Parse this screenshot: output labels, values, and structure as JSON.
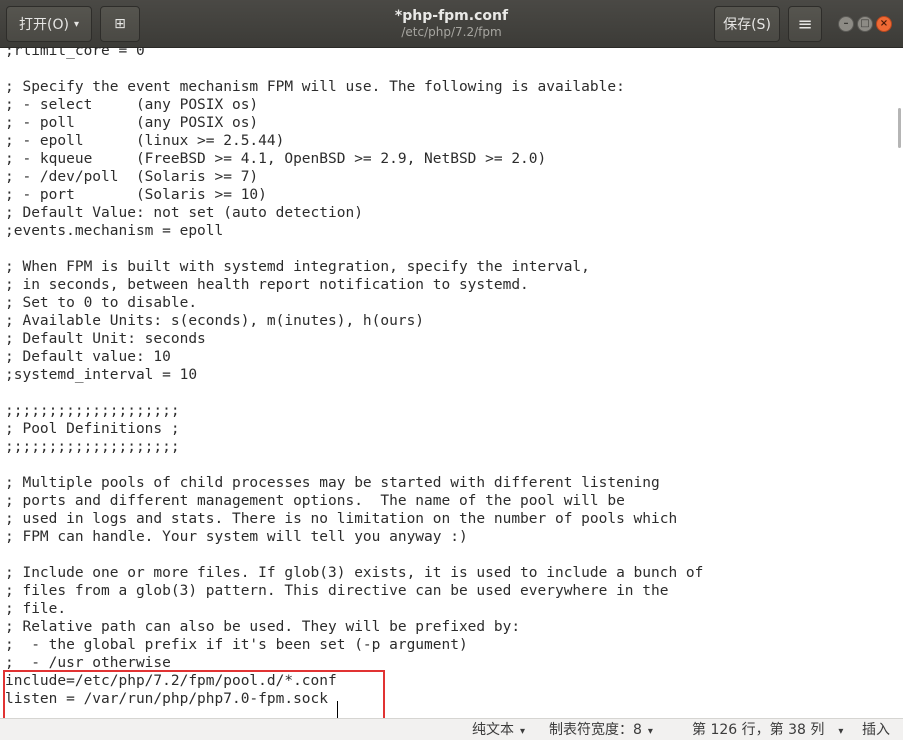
{
  "titlebar": {
    "open_label": "打开(O)",
    "open_caret": "▾",
    "newtab_icon": "⊞",
    "title": "*php-fpm.conf",
    "path": "/etc/php/7.2/fpm",
    "save_label": "保存(S)",
    "menu_icon": "≡",
    "minimize_icon": "–",
    "maximize_icon": "□",
    "close_icon": "×"
  },
  "editor": {
    "lines": [
      ";rlimit_core = 0",
      "",
      "; Specify the event mechanism FPM will use. The following is available:",
      "; - select     (any POSIX os)",
      "; - poll       (any POSIX os)",
      "; - epoll      (linux >= 2.5.44)",
      "; - kqueue     (FreeBSD >= 4.1, OpenBSD >= 2.9, NetBSD >= 2.0)",
      "; - /dev/poll  (Solaris >= 7)",
      "; - port       (Solaris >= 10)",
      "; Default Value: not set (auto detection)",
      ";events.mechanism = epoll",
      "",
      "; When FPM is built with systemd integration, specify the interval,",
      "; in seconds, between health report notification to systemd.",
      "; Set to 0 to disable.",
      "; Available Units: s(econds), m(inutes), h(ours)",
      "; Default Unit: seconds",
      "; Default value: 10",
      ";systemd_interval = 10",
      "",
      ";;;;;;;;;;;;;;;;;;;;",
      "; Pool Definitions ;",
      ";;;;;;;;;;;;;;;;;;;;",
      "",
      "; Multiple pools of child processes may be started with different listening",
      "; ports and different management options.  The name of the pool will be",
      "; used in logs and stats. There is no limitation on the number of pools which",
      "; FPM can handle. Your system will tell you anyway :)",
      "",
      "; Include one or more files. If glob(3) exists, it is used to include a bunch of",
      "; files from a glob(3) pattern. This directive can be used everywhere in the",
      "; file.",
      "; Relative path can also be used. They will be prefixed by:",
      ";  - the global prefix if it's been set (-p argument)",
      ";  - /usr otherwise",
      "include=/etc/php/7.2/fpm/pool.d/*.conf",
      "listen = /var/run/php/php7.0-fpm.sock"
    ]
  },
  "statusbar": {
    "syntax": "纯文本",
    "tab_width": "制表符宽度：8",
    "position": "第 126 行，第 38 列",
    "mode": "插入",
    "caret": "▾"
  }
}
